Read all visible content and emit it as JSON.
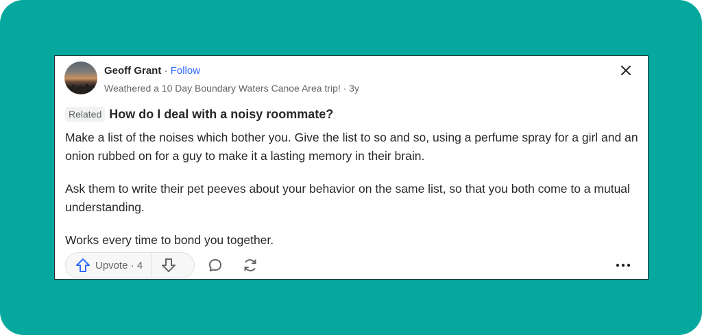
{
  "author": {
    "name": "Geoff Grant",
    "separator": "·",
    "follow_label": "Follow",
    "credential": "Weathered a 10 Day Boundary Waters Canoe Area trip! · 3y"
  },
  "related": {
    "chip_label": "Related",
    "question": "How do I deal with a noisy roommate?"
  },
  "answer": {
    "paragraphs": [
      "Make a list of the noises which bother you. Give the list to so and so, using a perfume spray for a girl and an onion rubbed on for a guy to make it a lasting memory in their brain.",
      "Ask them to write their pet peeves about your behavior on the same list, so that you both come to a mutual understanding.",
      "Works every time to bond you together."
    ]
  },
  "actions": {
    "upvote_label": "Upvote · 4"
  },
  "icons": {
    "close": "close-icon",
    "upvote": "upvote-arrow-icon",
    "downvote": "downvote-arrow-icon",
    "comment": "comment-icon",
    "share": "share-icon",
    "more": "more-options-icon"
  },
  "colors": {
    "background_frame": "#06a89e",
    "link_blue": "#2e69ff",
    "text_primary": "#282829",
    "text_secondary": "#636466"
  }
}
